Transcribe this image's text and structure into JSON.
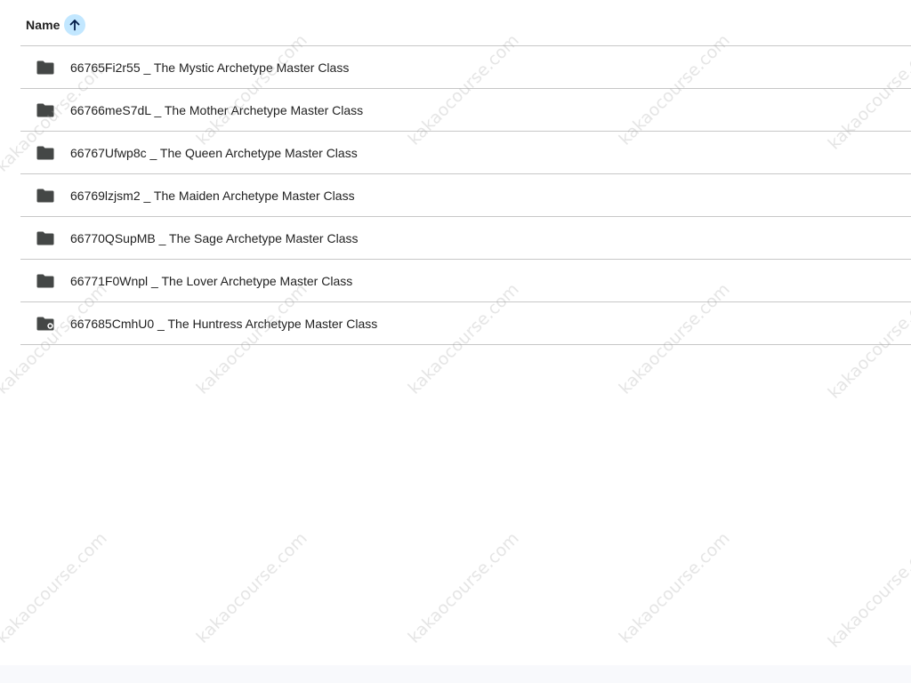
{
  "list_header": {
    "name_label": "Name",
    "sort_icon": "arrow-up-icon"
  },
  "files": [
    {
      "name": "66765Fi2r55 _ The Mystic Archetype Master Class",
      "icon": "folder-icon"
    },
    {
      "name": "66766meS7dL _ The Mother Archetype Master Class",
      "icon": "folder-icon"
    },
    {
      "name": "66767Ufwp8c _ The Queen Archetype Master Class",
      "icon": "folder-icon"
    },
    {
      "name": "66769lzjsm2 _ The Maiden Archetype Master Class",
      "icon": "folder-icon"
    },
    {
      "name": "66770QSupMB _ The Sage Archetype Master Class",
      "icon": "folder-icon"
    },
    {
      "name": "66771F0Wnpl _ The Lover Archetype Master Class",
      "icon": "folder-icon"
    },
    {
      "name": "667685CmhU0 _ The Huntress Archetype Master Class",
      "icon": "folder-icon"
    }
  ],
  "watermark": {
    "text": "kakaocourse.com"
  },
  "colors": {
    "sort_button_bg": "#c2e7ff",
    "divider": "#c7c7c7",
    "text": "#1f1f1f",
    "folder_icon": "#444746"
  }
}
